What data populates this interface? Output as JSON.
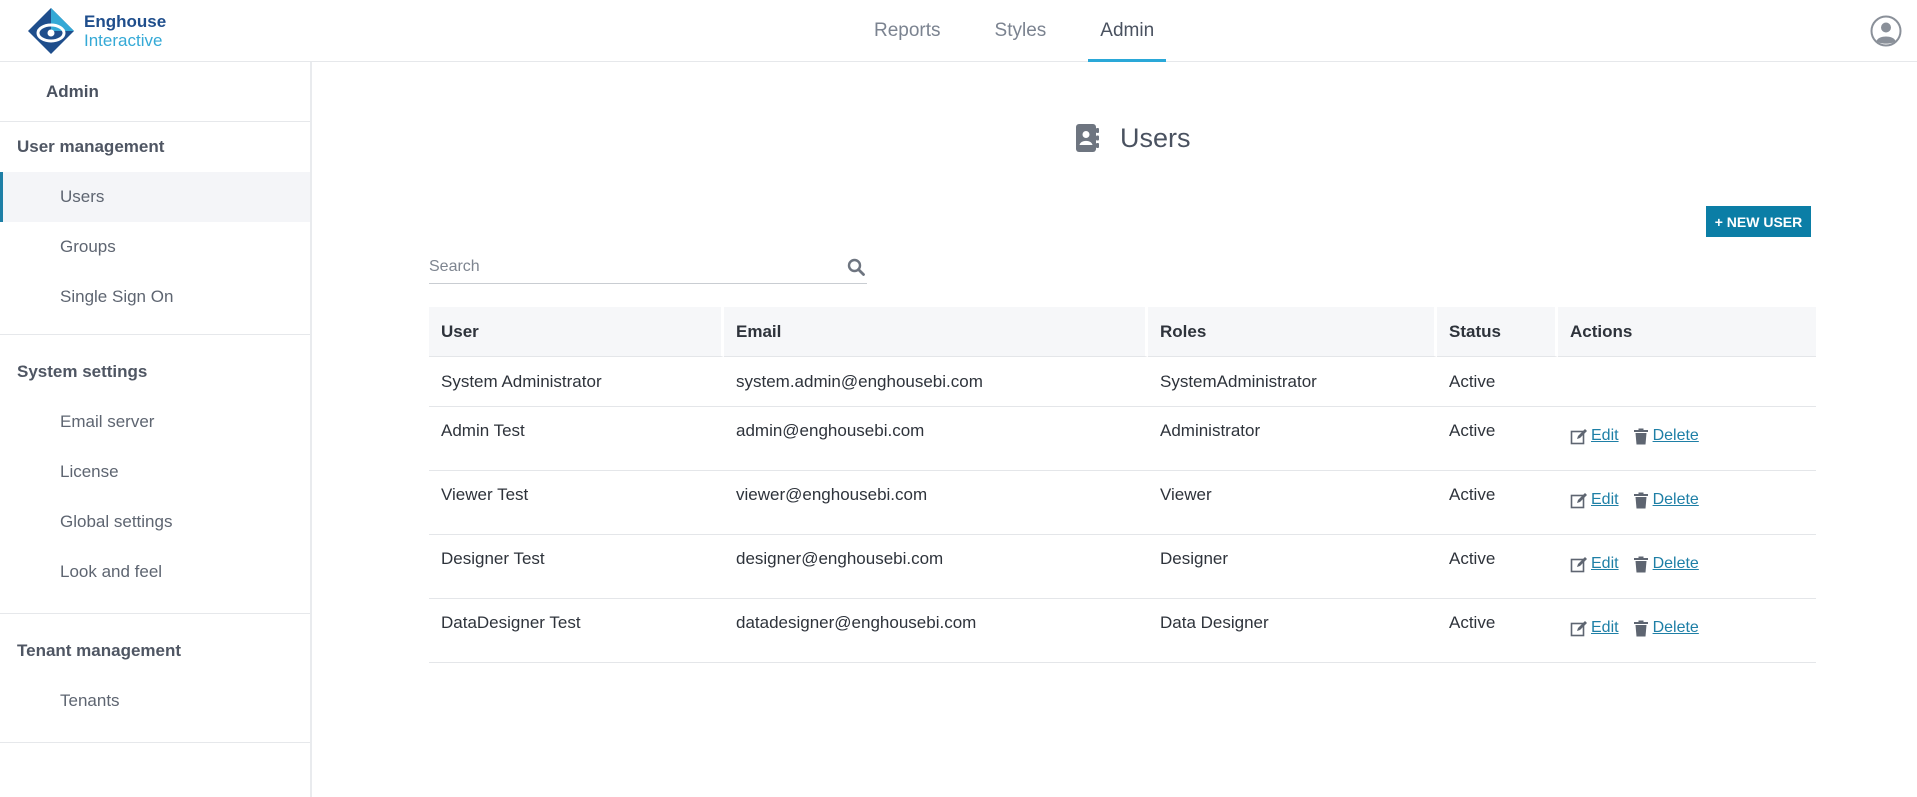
{
  "header": {
    "logo_line1": "Enghouse",
    "logo_line2": "Interactive",
    "nav": [
      {
        "label": "Reports",
        "active": false
      },
      {
        "label": "Styles",
        "active": false
      },
      {
        "label": "Admin",
        "active": true
      }
    ],
    "user_icon": "user-circle-icon"
  },
  "sidebar": {
    "title": "Admin",
    "groups": [
      {
        "header": "User management",
        "items": [
          {
            "label": "Users",
            "active": true
          },
          {
            "label": "Groups"
          },
          {
            "label": "Single Sign On"
          }
        ]
      },
      {
        "header": "System settings",
        "items": [
          {
            "label": "Email server"
          },
          {
            "label": "License"
          },
          {
            "label": "Global settings"
          },
          {
            "label": "Look and feel"
          }
        ]
      },
      {
        "header": "Tenant management",
        "items": [
          {
            "label": "Tenants"
          }
        ]
      }
    ]
  },
  "main": {
    "title": "Users",
    "title_icon": "address-book-icon",
    "new_user_label": "+ NEW USER",
    "search": {
      "placeholder": "Search",
      "value": ""
    },
    "table": {
      "columns": [
        "User",
        "Email",
        "Roles",
        "Status",
        "Actions"
      ],
      "rows": [
        {
          "user": "System Administrator",
          "email": "system.admin@enghousebi.com",
          "role": "SystemAdministrator",
          "status": "Active",
          "actions": false
        },
        {
          "user": "Admin Test",
          "email": "admin@enghousebi.com",
          "role": "Administrator",
          "status": "Active",
          "actions": true
        },
        {
          "user": "Viewer Test",
          "email": "viewer@enghousebi.com",
          "role": "Viewer",
          "status": "Active",
          "actions": true
        },
        {
          "user": "Designer Test",
          "email": "designer@enghousebi.com",
          "role": "Designer",
          "status": "Active",
          "actions": true
        },
        {
          "user": "DataDesigner Test",
          "email": "datadesigner@enghousebi.com",
          "role": "Data Designer",
          "status": "Active",
          "actions": true
        }
      ],
      "edit_label": "Edit",
      "delete_label": "Delete"
    }
  },
  "colors": {
    "accent": "#0b7ea6",
    "nav_underline": "#2aa8d8",
    "logo_dark": "#1f4e8c",
    "logo_light": "#34a9d6"
  }
}
